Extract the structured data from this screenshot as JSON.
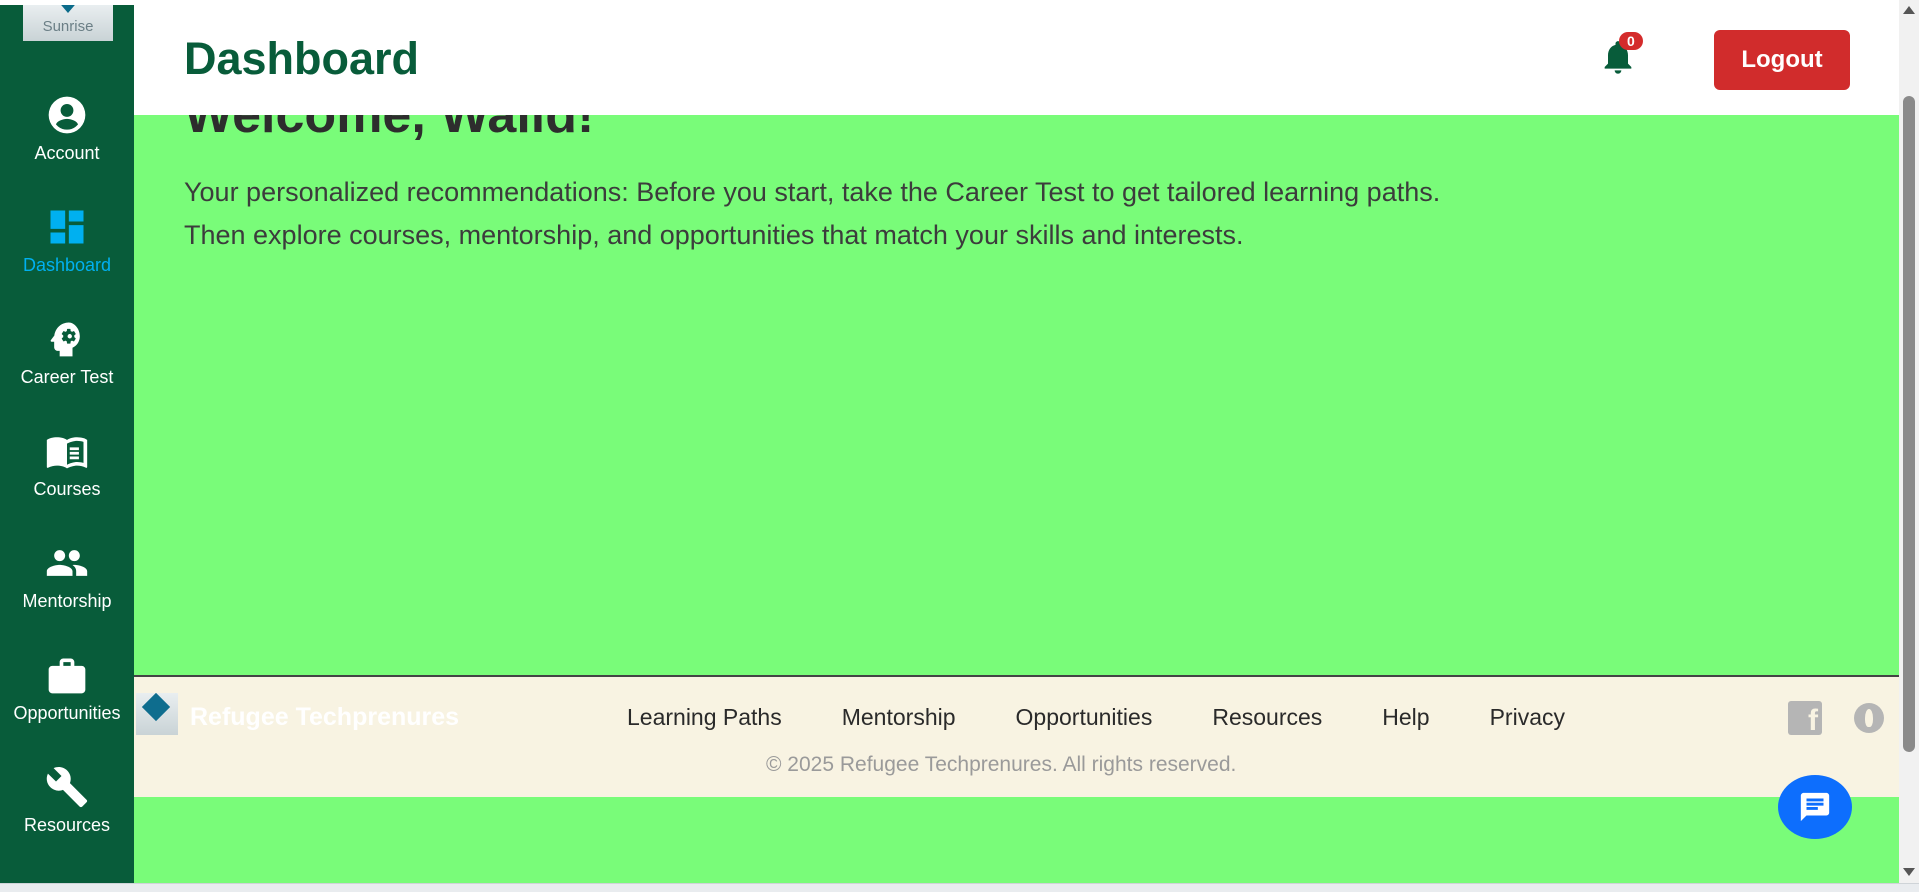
{
  "sidebar": {
    "logo_text": "Sunrise",
    "items": [
      {
        "label": "Account",
        "icon": "account-circle-icon"
      },
      {
        "label": "Dashboard",
        "icon": "dashboard-grid-icon",
        "active": true
      },
      {
        "label": "Career Test",
        "icon": "brain-head-icon"
      },
      {
        "label": "Courses",
        "icon": "open-book-icon"
      },
      {
        "label": "Mentorship",
        "icon": "people-icon"
      },
      {
        "label": "Opportunities",
        "icon": "briefcase-icon"
      },
      {
        "label": "Resources",
        "icon": "wrench-icon"
      }
    ]
  },
  "header": {
    "title": "Dashboard",
    "notification_count": "0",
    "logout_label": "Logout"
  },
  "main": {
    "welcome": "Welcome, Walid!",
    "recommendation_line1": "Your personalized recommendations: Before you start, take the Career Test to get tailored learning paths.",
    "recommendation_line2": "Then explore courses, mentorship, and opportunities that match your skills and interests."
  },
  "footer": {
    "brand": "Refugee Techprenures",
    "links": [
      "Learning Paths",
      "Mentorship",
      "Opportunities",
      "Resources",
      "Help",
      "Privacy"
    ],
    "copyright": "© 2025 Refugee Techprenures. All rights reserved.",
    "social": [
      "facebook-icon",
      "social-icon"
    ]
  },
  "colors": {
    "sidebar_bg": "#085c3a",
    "active_nav": "#00b0f0",
    "main_bg": "#79fc79",
    "footer_bg": "#f8f3e2",
    "logout_bg": "#d12c2c",
    "chat_bg": "#0d6efd"
  }
}
